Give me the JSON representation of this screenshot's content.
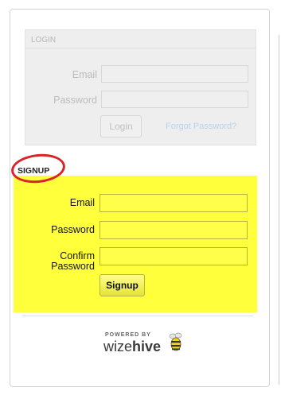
{
  "login": {
    "header": "LOGIN",
    "email_label": "Email",
    "password_label": "Password",
    "email_value": "",
    "password_value": "",
    "button_label": "Login",
    "forgot_link": "Forgot Password?"
  },
  "signup": {
    "header": "SIGNUP",
    "email_label": "Email",
    "password_label": "Password",
    "confirm_label_line1": "Confirm",
    "confirm_label_line2": "Password",
    "email_value": "",
    "password_value": "",
    "confirm_value": "",
    "button_label": "Signup"
  },
  "branding": {
    "powered_by": "POWERED BY",
    "name_prefix": "wize",
    "name_suffix": "hive",
    "logo_icon": "bee-icon"
  },
  "colors": {
    "highlight": "#ffff3b",
    "annotation_circle": "#d9242a"
  }
}
